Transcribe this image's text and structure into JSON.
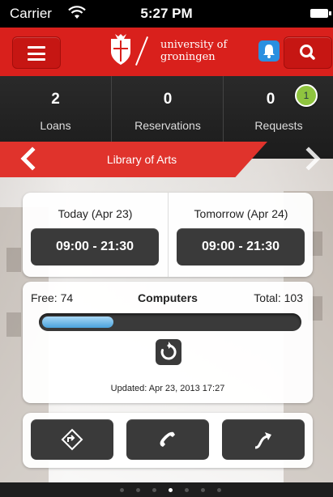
{
  "status_bar": {
    "carrier": "Carrier",
    "time": "5:27 PM"
  },
  "header": {
    "logo_line1": "university of",
    "logo_line2": "groningen",
    "brand_color": "#d9201c"
  },
  "stats": [
    {
      "value": "2",
      "label": "Loans"
    },
    {
      "value": "0",
      "label": "Reservations"
    },
    {
      "value": "0",
      "label": "Requests",
      "badge": "1"
    }
  ],
  "library": {
    "name": "Library of Arts"
  },
  "hours": {
    "today_label": "Today (Apr 23)",
    "today_hours": "09:00 - 21:30",
    "tomorrow_label": "Tomorrow (Apr 24)",
    "tomorrow_hours": "09:00 - 21:30"
  },
  "computers": {
    "free_text": "Free: 74",
    "title": "Computers",
    "total_text": "Total: 103",
    "used_fraction": 0.28,
    "updated": "Updated: Apr 23, 2013 17:27"
  },
  "actions": [
    "directions-icon",
    "phone-icon",
    "share-icon"
  ],
  "pagination": {
    "count": 7,
    "active": 3
  }
}
